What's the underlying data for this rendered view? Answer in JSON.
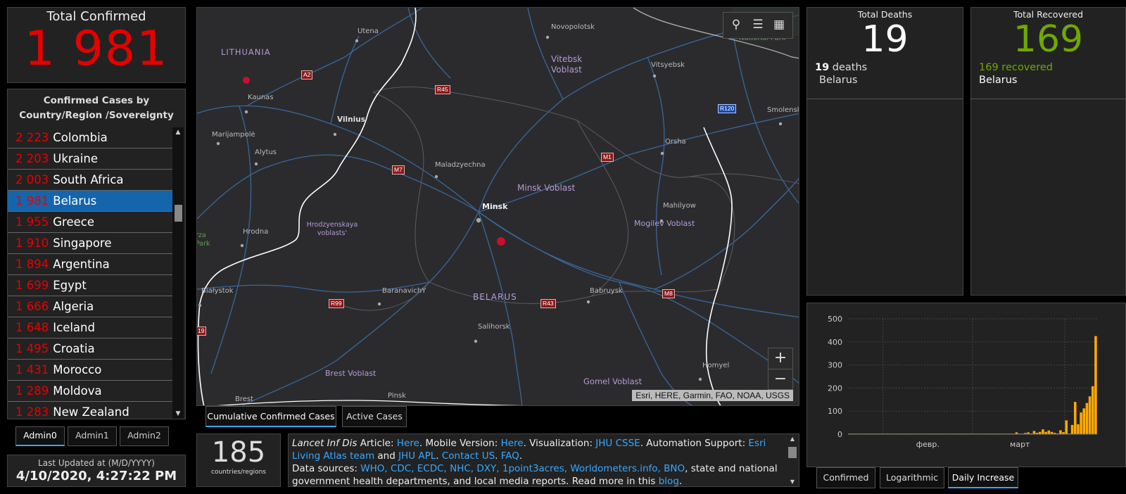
{
  "total_confirmed": {
    "label": "Total Confirmed",
    "value": "1 981"
  },
  "country_list": {
    "header": "Confirmed Cases by Country/Region /Sovereignty",
    "items": [
      {
        "count": "2 223",
        "name": "Colombia"
      },
      {
        "count": "2 203",
        "name": "Ukraine"
      },
      {
        "count": "2 003",
        "name": "South Africa"
      },
      {
        "count": "1 981",
        "name": "Belarus",
        "selected": true
      },
      {
        "count": "1 955",
        "name": "Greece"
      },
      {
        "count": "1 910",
        "name": "Singapore"
      },
      {
        "count": "1 894",
        "name": "Argentina"
      },
      {
        "count": "1 699",
        "name": "Egypt"
      },
      {
        "count": "1 666",
        "name": "Algeria"
      },
      {
        "count": "1 648",
        "name": "Iceland"
      },
      {
        "count": "1 495",
        "name": "Croatia"
      },
      {
        "count": "1 431",
        "name": "Morocco"
      },
      {
        "count": "1 289",
        "name": "Moldova"
      },
      {
        "count": "1 283",
        "name": "New Zealand"
      }
    ]
  },
  "admin_tabs": [
    "Admin0",
    "Admin1",
    "Admin2"
  ],
  "last_updated": {
    "label": "Last Updated at (M/D/YYYY)",
    "value": "4/10/2020, 4:27:22 PM"
  },
  "map": {
    "labels": {
      "lithuania": "LITHUANIA",
      "utena": "Utena",
      "novopolotsk": "Novopolotsk",
      "national_park": "National Park",
      "vitebsk": "Vitebsk Voblast",
      "vitsyebsk": "Vitsyebsk",
      "kaunas": "Kaunas",
      "vilnius": "Vilnius",
      "marijampole": "Marijampolė",
      "alytus": "Alytus",
      "smolensk": "Smolensk",
      "orsha": "Orsha",
      "maladzyechna": "Maladzyechna",
      "minsk_voblast": "Minsk Voblast",
      "minsk": "Minsk",
      "mahilyow": "Mahilyow",
      "mogilev": "Mogilev Voblast",
      "hrodna": "Hrodna",
      "hrodzyenskaya": "Hrodzyenskaya voblasts'",
      "bialystok": "Białystok",
      "baranavichy": "BaranavichY",
      "belarus": "BELARUS",
      "babruysk": "Babruysk",
      "salihorsk": "Salihorsk",
      "brest_voblast": "Brest Voblast",
      "gomel": "Gomel Voblast",
      "homyel": "Homyel",
      "brest": "Brest",
      "pinsk": "Pinsk",
      "park": "rza Park"
    },
    "shields": [
      "A2",
      "R45",
      "R120",
      "M1",
      "M7",
      "R99",
      "R43",
      "M8",
      "19"
    ],
    "attribution": "Esri, HERE, Garmin, FAO, NOAA, USGS",
    "tools": [
      "bookmark-icon",
      "list-icon",
      "qr-icon"
    ],
    "zoom_in": "+",
    "zoom_out": "−"
  },
  "map_tabs": [
    "Cumulative Confirmed Cases",
    "Active Cases"
  ],
  "countries_count": {
    "value": "185",
    "label": "countries/regions"
  },
  "info": {
    "p1_italic": "Lancet Inf Dis",
    "p1_a": " Article: ",
    "l_here1": "Here",
    "p1_b": ". Mobile Version: ",
    "l_here2": "Here",
    "p1_c": ". Visualization: ",
    "l_jhu": "JHU CSSE",
    "p1_d": ". Automation Support: ",
    "l_esri": "Esri Living Atlas team",
    "p1_e": " and ",
    "l_apl": "JHU APL",
    "p1_f": ". ",
    "l_contact": "Contact US",
    "p1_g": ". ",
    "l_faq": "FAQ",
    "p1_h": ".",
    "p2_a": "Data sources: ",
    "l_sources": "WHO, CDC, ECDC, NHC, DXY, 1point3acres, Worldometers.info, BNO",
    "p2_b": ", state and national government health departments, and local media reports.  Read more in this ",
    "l_blog": "blog",
    "p2_c": "."
  },
  "deaths": {
    "label": "Total Deaths",
    "value": "19",
    "sub_count": "19",
    "sub_word": " deaths",
    "sub_region": "Belarus"
  },
  "recovered": {
    "label": "Total Recovered",
    "value": "169",
    "sub_count": "169",
    "sub_word": " recovered",
    "sub_region": "Belarus"
  },
  "colors": {
    "confirmed": "#e60000",
    "recovered": "#70a800",
    "accent": "#37a8ff",
    "bar": "#ffaa00"
  },
  "chart_data": {
    "type": "bar",
    "x_tick_labels": [
      "февр.",
      "март"
    ],
    "ylim": [
      0,
      500
    ],
    "yticks": [
      0,
      100,
      200,
      300,
      400,
      500
    ],
    "values": [
      0,
      0,
      0,
      0,
      0,
      0,
      0,
      0,
      0,
      0,
      0,
      0,
      0,
      0,
      0,
      0,
      0,
      0,
      0,
      0,
      0,
      0,
      0,
      0,
      0,
      0,
      0,
      0,
      0,
      0,
      0,
      0,
      0,
      0,
      0,
      0,
      0,
      0,
      0,
      0,
      0,
      0,
      1,
      0,
      0,
      0,
      0,
      0,
      0,
      0,
      0,
      0,
      0,
      0,
      0,
      0,
      0,
      8,
      0,
      0,
      5,
      8,
      3,
      14,
      6,
      10,
      21,
      10,
      16,
      10,
      6,
      3,
      17,
      9,
      60,
      2,
      40,
      140,
      43,
      94,
      112,
      135,
      164,
      208,
      425
    ],
    "grid": true,
    "title": ""
  },
  "chart_tabs": [
    "Confirmed",
    "Logarithmic",
    "Daily Increase"
  ]
}
